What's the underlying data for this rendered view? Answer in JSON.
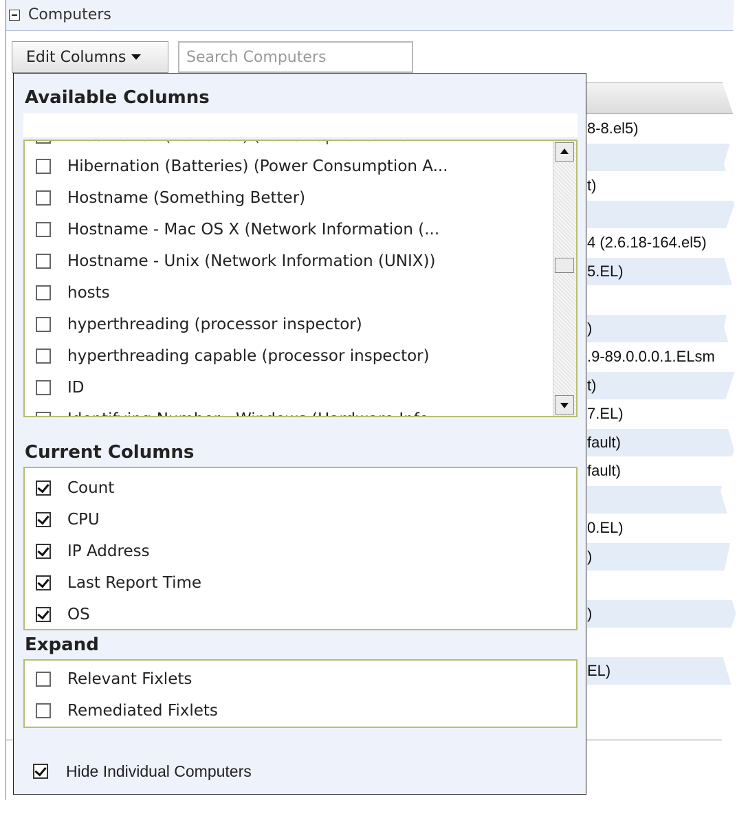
{
  "header": {
    "title": "Computers",
    "edit_columns_label": "Edit Columns",
    "search_placeholder": "Search Computers"
  },
  "background_rows": [
    {
      "text": "8-8.el5)",
      "alt": false
    },
    {
      "text": "",
      "alt": true
    },
    {
      "text": "t)",
      "alt": false
    },
    {
      "text": "",
      "alt": true
    },
    {
      "text": "4 (2.6.18-164.el5)",
      "alt": false
    },
    {
      "text": "5.EL)",
      "alt": true
    },
    {
      "text": "",
      "alt": false
    },
    {
      "text": ")",
      "alt": true
    },
    {
      "text": ".9-89.0.0.0.1.ELsm",
      "alt": false
    },
    {
      "text": "t)",
      "alt": true
    },
    {
      "text": "7.EL)",
      "alt": false
    },
    {
      "text": "fault)",
      "alt": true
    },
    {
      "text": "fault)",
      "alt": false
    },
    {
      "text": "",
      "alt": true
    },
    {
      "text": "0.EL)",
      "alt": false
    },
    {
      "text": ")",
      "alt": true
    },
    {
      "text": "",
      "alt": false
    },
    {
      "text": ")",
      "alt": true
    },
    {
      "text": "",
      "alt": false
    },
    {
      "text": "EL)",
      "alt": true
    }
  ],
  "available_columns": {
    "heading": "Available Columns",
    "partial_top": "Hibernation (Batteries) (Power Options Inform...",
    "items": [
      {
        "label": "Hibernation (Batteries) (Power Consumption A...",
        "checked": false
      },
      {
        "label": "Hostname (Something Better)",
        "checked": false
      },
      {
        "label": "Hostname - Mac OS X (Network Information (...",
        "checked": false
      },
      {
        "label": "Hostname - Unix (Network Information (UNIX))",
        "checked": false
      },
      {
        "label": "hosts",
        "checked": false
      },
      {
        "label": "hyperthreading (processor inspector)",
        "checked": false
      },
      {
        "label": "hyperthreading capable (processor inspector)",
        "checked": false
      },
      {
        "label": "ID",
        "checked": false
      }
    ],
    "partial_bottom": "Identifying Number - Windows (Hardware Info..."
  },
  "current_columns": {
    "heading": "Current Columns",
    "items": [
      {
        "label": "Count",
        "checked": true
      },
      {
        "label": "CPU",
        "checked": true
      },
      {
        "label": "IP Address",
        "checked": true
      },
      {
        "label": "Last Report Time",
        "checked": true
      },
      {
        "label": "OS",
        "checked": true
      }
    ]
  },
  "expand": {
    "heading": "Expand",
    "items": [
      {
        "label": "Relevant Fixlets",
        "checked": false
      },
      {
        "label": "Remediated Fixlets",
        "checked": false
      }
    ]
  },
  "hide_individual": {
    "label": "Hide Individual Computers",
    "checked": true
  }
}
